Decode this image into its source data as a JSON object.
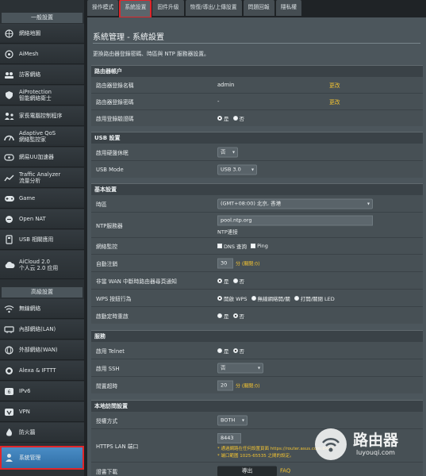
{
  "sidebar": {
    "general_header": "一般設置",
    "advanced_header": "高級設置",
    "general_items": [
      {
        "label": "網絡地圖",
        "icon": "network-map-icon"
      },
      {
        "label": "AiMesh",
        "icon": "aimesh-icon"
      },
      {
        "label": "訪客網絡",
        "icon": "guest-network-icon"
      },
      {
        "label": "AiProtection\n智能網絡衛士",
        "icon": "shield-icon"
      },
      {
        "label": "家長電腦控制程序",
        "icon": "family-icon"
      },
      {
        "label": "Adaptive QoS\n網絡監控家",
        "icon": "qos-icon"
      },
      {
        "label": "網易UU加速器",
        "icon": "uu-accelerator-icon"
      },
      {
        "label": "Traffic Analyzer\n流量分析",
        "icon": "traffic-icon"
      },
      {
        "label": "Game",
        "icon": "gamepad-icon"
      },
      {
        "label": "Open NAT",
        "icon": "nat-icon"
      },
      {
        "label": "USB 相關應用",
        "icon": "usb-icon"
      },
      {
        "label": "AiCloud 2.0\n个人云 2.0 应用",
        "icon": "cloud-icon"
      }
    ],
    "advanced_items": [
      {
        "label": "無線網絡",
        "icon": "wireless-icon"
      },
      {
        "label": "內部網絡(LAN)",
        "icon": "lan-icon"
      },
      {
        "label": "外部網絡(WAN)",
        "icon": "wan-icon"
      },
      {
        "label": "Alexa & IFTTT",
        "icon": "alexa-icon"
      },
      {
        "label": "IPv6",
        "icon": "ipv6-icon"
      },
      {
        "label": "VPN",
        "icon": "vpn-icon"
      },
      {
        "label": "防火牆",
        "icon": "firewall-icon"
      },
      {
        "label": "系統管理",
        "icon": "admin-icon"
      }
    ]
  },
  "tabs": [
    "操作模式",
    "系統設置",
    "固件升級",
    "恢復/導出/上傳設置",
    "問題回報",
    "隱私權"
  ],
  "page": {
    "title": "系統管理 - 系統設置",
    "description": "更換路由器登錄密碼、時區與 NTP 服務器設置。"
  },
  "sections": {
    "account": {
      "header": "路由器帳户",
      "name_label": "路由器登錄名稱",
      "name_value": "admin",
      "name_link": "更改",
      "pass_label": "路由器登錄密碼",
      "pass_value": "-",
      "pass_link": "更改",
      "captcha_label": "啟用登錄驗證碼",
      "yes": "是",
      "no": "否"
    },
    "usb": {
      "header": "USB 設置",
      "hdd_label": "啟用硬盤休眠",
      "hdd_value": "否",
      "mode_label": "USB Mode",
      "mode_value": "USB 3.0"
    },
    "basic": {
      "header": "基本設置",
      "tz_label": "時區",
      "tz_value": "(GMT+08:00) 北京, 香港",
      "ntp_label": "NTP服務器",
      "ntp_value": "pool.ntp.org",
      "ntp_link": "NTP連接",
      "netmon_label": "網絡監控",
      "dns_query": "DNS 查詢",
      "ping": "Ping",
      "logout_label": "自動注銷",
      "logout_value": "30",
      "logout_hint": "分 (關閉:0)",
      "wan_label": "非當 WAN 中斷時路由器尋頁通知",
      "yes": "是",
      "no": "否",
      "wps_label": "WPS 按鈕行為",
      "wps_opt1": "開啟 WPS",
      "wps_opt2": "無線網絡開/關",
      "wps_opt3": "打開/關閉 LED",
      "reboot_label": "啟動定時重啟"
    },
    "service": {
      "header": "服務",
      "telnet_label": "啟用 Telnet",
      "ssh_label": "啟用 SSH",
      "ssh_value": "否",
      "idle_label": "閒置超時",
      "idle_value": "20",
      "idle_hint": "分 (關閉:0)",
      "yes": "是",
      "no": "否"
    },
    "local": {
      "header": "本地訪問設置",
      "auth_label": "授權方式",
      "auth_value": "BOTH",
      "https_label": "HTTPS LAN 端口",
      "https_value": "8443",
      "https_hint1": "* 通過網路在任何設置頁面 https://router.asus.com:8443",
      "https_hint2": "* 端口範圍 1025-65535 之間的設定。",
      "cert_label": "證書下載",
      "cert_button": "導出",
      "cert_faq": "FAQ"
    }
  },
  "watermark": {
    "text": "路由器",
    "url": "luyouqi.com"
  },
  "colors": {
    "accent": "#f1c232",
    "highlight": "#e0262b",
    "active_nav": "#3a7fba"
  }
}
